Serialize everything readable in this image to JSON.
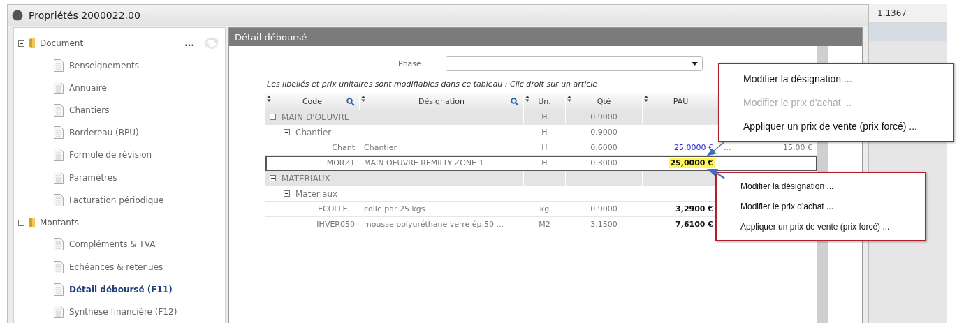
{
  "window": {
    "title": "Propriétés 2000022.00"
  },
  "side_grid": {
    "cells": [
      "1.1367"
    ]
  },
  "sidebar": {
    "more": "...",
    "groups": [
      {
        "label": "Document",
        "expanded": true,
        "items": [
          {
            "label": "Renseignements",
            "selected": false
          },
          {
            "label": "Annuaire",
            "selected": false
          },
          {
            "label": "Chantiers",
            "selected": false
          },
          {
            "label": "Bordereau (BPU)",
            "selected": false
          },
          {
            "label": "Formule de révision",
            "selected": false
          },
          {
            "label": "Paramètres",
            "selected": false
          },
          {
            "label": "Facturation périodique",
            "selected": false
          }
        ]
      },
      {
        "label": "Montants",
        "expanded": true,
        "items": [
          {
            "label": "Compléments & TVA",
            "selected": false
          },
          {
            "label": "Echéances & retenues",
            "selected": false
          },
          {
            "label": "Détail déboursé (F11)",
            "selected": true
          },
          {
            "label": "Synthèse financière (F12)",
            "selected": false
          }
        ]
      }
    ]
  },
  "panel": {
    "title": "Détail déboursé",
    "phase": {
      "label": "Phase :"
    },
    "hint": "Les libellés et prix unitaires sont modifiables dans ce tableau : Clic droit sur un article",
    "table": {
      "columns": [
        {
          "label": "Code",
          "searchable": true
        },
        {
          "label": "Désignation",
          "searchable": true
        },
        {
          "label": "Un.",
          "searchable": false
        },
        {
          "label": "Qté",
          "searchable": false
        },
        {
          "label": "PAU",
          "searchable": false
        }
      ],
      "rows": [
        {
          "kind": "group",
          "label": "MAIN D'OEUVRE",
          "expanded": true,
          "unit": "H",
          "qty": "0.9000",
          "selected": false
        },
        {
          "kind": "subgroup",
          "label": "Chantier",
          "expanded": true,
          "unit": "H",
          "qty": "0.9000",
          "selected": false
        },
        {
          "kind": "item",
          "code": "Chant",
          "designation": "Chantier",
          "unit": "H",
          "qty": "0.6000",
          "price": "25,0000 €",
          "price_edited": true,
          "extra": "...",
          "total": "15,00 €",
          "selected": false
        },
        {
          "kind": "item",
          "code": "MORZ1",
          "designation": "MAIN OEUVRE REMILLY ZONE 1",
          "unit": "H",
          "qty": "0.3000",
          "price": "25,0000 €",
          "price_edited": false,
          "selected": true
        },
        {
          "kind": "group",
          "label": "MATERIAUX",
          "expanded": true,
          "selected": false
        },
        {
          "kind": "subgroup",
          "label": "Matériaux",
          "expanded": true,
          "selected": false
        },
        {
          "kind": "item",
          "code": "ECOLLE...",
          "designation": "colle par 25 kgs",
          "unit": "kg",
          "qty": "0.9000",
          "price": "3,2900 €",
          "price_edited": false,
          "selected": false
        },
        {
          "kind": "item",
          "code": "IHVER050",
          "designation": "mousse polyuréthane verre ép.50 ...",
          "unit": "M2",
          "qty": "3.1500",
          "price": "7,6100 €",
          "price_edited": false,
          "selected": false
        }
      ]
    }
  },
  "context_menus": [
    {
      "items": [
        {
          "label": "Modifier la désignation ...",
          "disabled": false
        },
        {
          "label": "Modifier le prix d'achat ...",
          "disabled": true
        },
        {
          "label": "Appliquer un prix de vente (prix forcé) ...",
          "disabled": false
        }
      ]
    },
    {
      "items": [
        {
          "label": "Modifier la désignation ...",
          "disabled": false
        },
        {
          "label": "Modifier le prix d'achat ...",
          "disabled": false
        },
        {
          "label": "Appliquer un prix de vente (prix forcé) ...",
          "disabled": false
        }
      ]
    }
  ]
}
